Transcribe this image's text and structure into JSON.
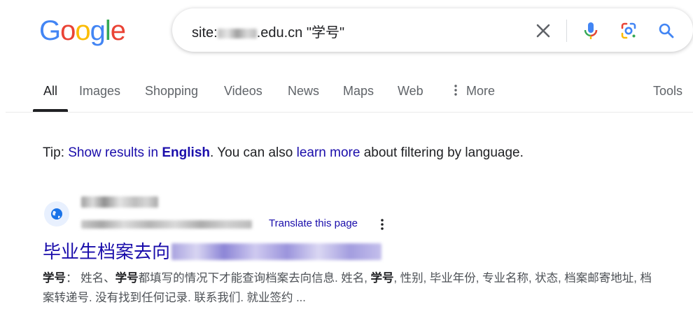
{
  "logo": {
    "letters": [
      "G",
      "o",
      "o",
      "g",
      "l",
      "e"
    ],
    "colors": [
      "#4285F4",
      "#EA4335",
      "#FBBC05",
      "#4285F4",
      "#34A853",
      "#EA4335"
    ]
  },
  "search": {
    "query_prefix": "site:",
    "query_suffix": ".edu.cn \"学号\"",
    "icons": {
      "clear": "close-icon",
      "voice": "mic-icon",
      "image": "lens-icon",
      "submit": "search-icon"
    }
  },
  "tabs": {
    "items": [
      "All",
      "Images",
      "Shopping",
      "Videos",
      "News",
      "Maps",
      "Web",
      "More"
    ],
    "more_icon": "vertical-dots-icon",
    "tools": "Tools",
    "active": "All"
  },
  "tip": {
    "prefix": "Tip: ",
    "show_results": "Show results in",
    "language": "English",
    "middle": ". You can also ",
    "learn_more": "learn more",
    "suffix": " about filtering by language."
  },
  "result": {
    "favicon": "globe-icon",
    "translate": "Translate this page",
    "menu_icon": "more-vert-icon",
    "title_visible": "毕业生档案去向",
    "snippet": {
      "s1_bold": "学号",
      "s1": "：  姓名、",
      "s2_bold": "学号",
      "s2": "都填写的情况下才能查询档案去向信息. 姓名, ",
      "s3_bold": "学号",
      "s3": ", 性别, 毕业年份, 专业名称, 状态, 档案邮寄地址, 档案转递号. 没有找到任何记录. 联系我们. 就业签约 ..."
    }
  }
}
